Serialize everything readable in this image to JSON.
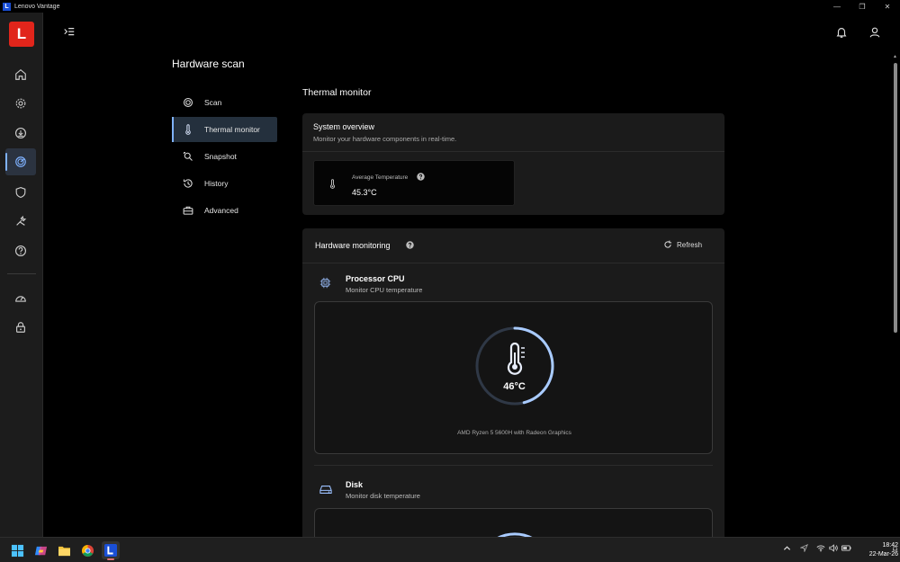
{
  "window": {
    "title": "Lenovo Vantage",
    "app_letter": "L"
  },
  "rail": {
    "logo": "L",
    "items": [
      {
        "icon": "home-icon"
      },
      {
        "icon": "gear-icon"
      },
      {
        "icon": "download-icon"
      },
      {
        "icon": "hardware-scan-icon",
        "active": true
      },
      {
        "icon": "shield-icon"
      },
      {
        "icon": "tools-icon"
      },
      {
        "icon": "help-icon"
      },
      {
        "icon": "speedometer-icon"
      },
      {
        "icon": "lock-icon"
      }
    ]
  },
  "page": {
    "title": "Hardware scan"
  },
  "subnav": {
    "items": [
      {
        "label": "Scan",
        "icon": "scan-icon"
      },
      {
        "label": "Thermal monitor",
        "icon": "thermometer-icon",
        "active": true
      },
      {
        "label": "Snapshot",
        "icon": "snapshot-icon"
      },
      {
        "label": "History",
        "icon": "history-icon"
      },
      {
        "label": "Advanced",
        "icon": "toolbox-icon"
      }
    ]
  },
  "section": {
    "title": "Thermal monitor"
  },
  "overview": {
    "title": "System overview",
    "subtitle": "Monitor your hardware components in real-time.",
    "avg_label": "Average Temperature",
    "avg_value": "45.3°C"
  },
  "monitoring": {
    "title": "Hardware monitoring",
    "refresh_label": "Refresh",
    "cpu": {
      "name": "Processor CPU",
      "subtitle": "Monitor CPU temperature",
      "temperature": "46°C",
      "gauge_fraction": 0.46,
      "model": "AMD Ryzen 5 5600H with Radeon Graphics"
    },
    "disk": {
      "name": "Disk",
      "subtitle": "Monitor disk temperature"
    }
  },
  "colors": {
    "accent": "#7fb2ff",
    "brand": "#e1251b",
    "card": "#1b1b1b"
  },
  "taskbar": {
    "time": "18:42",
    "date": "22-Mar-26"
  }
}
